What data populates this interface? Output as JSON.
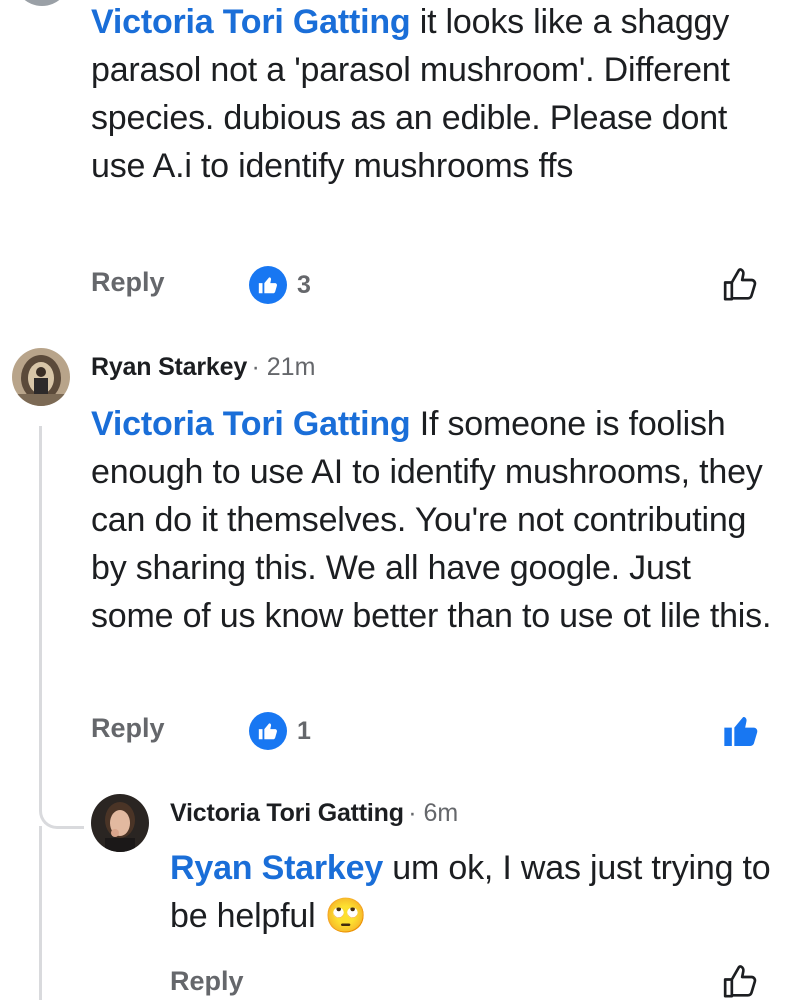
{
  "comments": [
    {
      "mention": "Victoria Tori Gatting",
      "text": " it looks like a shaggy parasol not a 'parasol mushroom'. Different species.  dubious as an edible. Please dont use A.i to identify mushrooms ffs",
      "reply_label": "Reply",
      "reaction_count": "3",
      "liked": false
    },
    {
      "author": "Ryan Starkey",
      "time": "· 21m",
      "mention": "Victoria Tori Gatting",
      "text": " If someone is foolish enough to use AI to identify mushrooms, they can do it themselves. You're not contributing by sharing this. We all have google. Just some of us know better than to use ot lile this.",
      "reply_label": "Reply",
      "reaction_count": "1",
      "liked": true
    },
    {
      "author": "Victoria Tori Gatting",
      "time": "· 6m",
      "mention": "Ryan Starkey",
      "text": " um ok, I was just trying to be helpful 🙄",
      "reply_label": "Reply",
      "liked": false
    }
  ],
  "colors": {
    "mention": "#1a6ed8",
    "like_blue": "#1877f2",
    "muted": "#65676b",
    "thread_line": "#d9dadd"
  },
  "icons": {
    "reaction": "thumbs-up-reaction-icon",
    "like": "thumbs-up-icon",
    "emoji": "eye-roll-emoji"
  }
}
